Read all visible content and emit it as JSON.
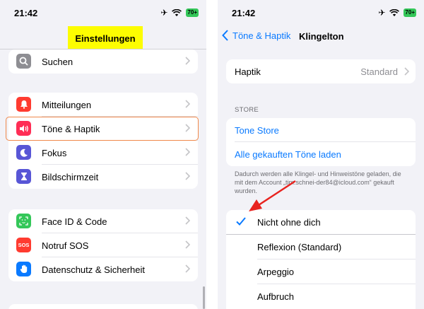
{
  "left": {
    "status": {
      "time": "21:42",
      "battery": "70+"
    },
    "title": "Einstellungen",
    "groups": [
      [
        {
          "label": "Suchen",
          "icon": "search-icon",
          "color": "#8e8e93"
        }
      ],
      [
        {
          "label": "Mitteilungen",
          "icon": "bell-icon",
          "color": "#ff3b30"
        },
        {
          "label": "Töne & Haptik",
          "icon": "speaker-icon",
          "color": "#ff2d55"
        },
        {
          "label": "Fokus",
          "icon": "moon-icon",
          "color": "#5856d6"
        },
        {
          "label": "Bildschirmzeit",
          "icon": "hourglass-icon",
          "color": "#5856d6"
        }
      ],
      [
        {
          "label": "Face ID & Code",
          "icon": "face-id-icon",
          "color": "#34c759"
        },
        {
          "label": "Notruf SOS",
          "icon": "sos-icon",
          "color": "#ff3b30",
          "badge": "SOS"
        },
        {
          "label": "Datenschutz & Sicherheit",
          "icon": "hand-icon",
          "color": "#0a7aff"
        }
      ]
    ]
  },
  "right": {
    "status": {
      "time": "21:42",
      "battery": "70+"
    },
    "nav": {
      "back_label": "Töne & Haptik",
      "title": "Klingelton"
    },
    "haptik": {
      "label": "Haptik",
      "value": "Standard"
    },
    "store": {
      "header": "STORE",
      "items": [
        "Tone Store",
        "Alle gekauften Töne laden"
      ],
      "note": "Dadurch werden alle Klingel- und Hinweistöne geladen, die mit dem Account „tim.schnei-der84@icloud.com“ gekauft wurden."
    },
    "tones": [
      {
        "label": "Nicht ohne dich",
        "selected": true
      },
      {
        "label": "Reflexion (Standard)",
        "selected": false
      },
      {
        "label": "Arpeggio",
        "selected": false
      },
      {
        "label": "Aufbruch",
        "selected": false
      }
    ]
  },
  "colors": {
    "accent": "#0a7aff",
    "highlight": "#fdfd00",
    "annotation": "#e8231f",
    "selection_outline": "#f0884a"
  }
}
